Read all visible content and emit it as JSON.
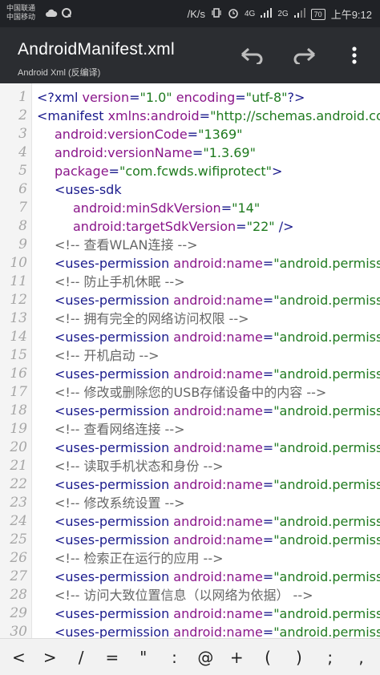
{
  "status_bar": {
    "carrier1": "中国联通",
    "carrier2": "中国移动",
    "speed": "/K/s",
    "net1": "4G",
    "net2": "2G",
    "battery": "70",
    "time": "上午9:12"
  },
  "toolbar": {
    "title": "AndroidManifest.xml",
    "subtitle": "Android Xml (反编译)"
  },
  "editor": {
    "lines": [
      {
        "n": "1",
        "parts": [
          [
            "tag",
            "<?xml "
          ],
          [
            "attr",
            "version"
          ],
          [
            "tag",
            "="
          ],
          [
            "str",
            "\"1.0\""
          ],
          [
            "tag",
            " "
          ],
          [
            "attr",
            "encoding"
          ],
          [
            "tag",
            "="
          ],
          [
            "str",
            "\"utf-8\""
          ],
          [
            "tag",
            "?>"
          ]
        ],
        "indent": 0
      },
      {
        "n": "2",
        "parts": [
          [
            "tag",
            "<manifest "
          ],
          [
            "attr",
            "xmlns:android"
          ],
          [
            "tag",
            "="
          ],
          [
            "str",
            "\"http://schemas.android.com/apk"
          ]
        ],
        "indent": 0
      },
      {
        "n": "3",
        "parts": [
          [
            "attr",
            "android:versionCode"
          ],
          [
            "tag",
            "="
          ],
          [
            "str",
            "\"1369\""
          ]
        ],
        "indent": 1
      },
      {
        "n": "4",
        "parts": [
          [
            "attr",
            "android:versionName"
          ],
          [
            "tag",
            "="
          ],
          [
            "str",
            "\"1.3.69\""
          ]
        ],
        "indent": 1
      },
      {
        "n": "5",
        "parts": [
          [
            "attr",
            "package"
          ],
          [
            "tag",
            "="
          ],
          [
            "str",
            "\"com.fcwds.wifiprotect\""
          ],
          [
            "tag",
            ">"
          ]
        ],
        "indent": 1
      },
      {
        "n": "6",
        "parts": [
          [
            "tag",
            "<uses-sdk"
          ]
        ],
        "indent": 1
      },
      {
        "n": "7",
        "parts": [
          [
            "attr",
            "android:minSdkVersion"
          ],
          [
            "tag",
            "="
          ],
          [
            "str",
            "\"14\""
          ]
        ],
        "indent": 2
      },
      {
        "n": "8",
        "parts": [
          [
            "attr",
            "android:targetSdkVersion"
          ],
          [
            "tag",
            "="
          ],
          [
            "str",
            "\"22\""
          ],
          [
            "tag",
            " />"
          ]
        ],
        "indent": 2
      },
      {
        "n": "9",
        "parts": [
          [
            "comment",
            "<!-- 查看WLAN连接 -->"
          ]
        ],
        "indent": 1
      },
      {
        "n": "10",
        "parts": [
          [
            "tag",
            "<uses-permission "
          ],
          [
            "attr",
            "android:name"
          ],
          [
            "tag",
            "="
          ],
          [
            "str",
            "\"android.permission.ACC"
          ]
        ],
        "indent": 1
      },
      {
        "n": "11",
        "parts": [
          [
            "comment",
            "<!-- 防止手机休眠 -->"
          ]
        ],
        "indent": 1
      },
      {
        "n": "12",
        "parts": [
          [
            "tag",
            "<uses-permission "
          ],
          [
            "attr",
            "android:name"
          ],
          [
            "tag",
            "="
          ],
          [
            "str",
            "\"android.permission.WAK"
          ]
        ],
        "indent": 1
      },
      {
        "n": "13",
        "parts": [
          [
            "comment",
            "<!-- 拥有完全的网络访问权限 -->"
          ]
        ],
        "indent": 1
      },
      {
        "n": "14",
        "parts": [
          [
            "tag",
            "<uses-permission "
          ],
          [
            "attr",
            "android:name"
          ],
          [
            "tag",
            "="
          ],
          [
            "str",
            "\"android.permission.INT"
          ]
        ],
        "indent": 1
      },
      {
        "n": "15",
        "parts": [
          [
            "comment",
            "<!-- 开机启动 -->"
          ]
        ],
        "indent": 1
      },
      {
        "n": "16",
        "parts": [
          [
            "tag",
            "<uses-permission "
          ],
          [
            "attr",
            "android:name"
          ],
          [
            "tag",
            "="
          ],
          [
            "str",
            "\"android.permission.REC"
          ]
        ],
        "indent": 1
      },
      {
        "n": "17",
        "parts": [
          [
            "comment",
            "<!-- 修改或删除您的USB存储设备中的内容 -->"
          ]
        ],
        "indent": 1
      },
      {
        "n": "18",
        "parts": [
          [
            "tag",
            "<uses-permission "
          ],
          [
            "attr",
            "android:name"
          ],
          [
            "tag",
            "="
          ],
          [
            "str",
            "\"android.permission.WRI"
          ]
        ],
        "indent": 1
      },
      {
        "n": "19",
        "parts": [
          [
            "comment",
            "<!-- 查看网络连接 -->"
          ]
        ],
        "indent": 1
      },
      {
        "n": "20",
        "parts": [
          [
            "tag",
            "<uses-permission "
          ],
          [
            "attr",
            "android:name"
          ],
          [
            "tag",
            "="
          ],
          [
            "str",
            "\"android.permission.ACC"
          ]
        ],
        "indent": 1
      },
      {
        "n": "21",
        "parts": [
          [
            "comment",
            "<!-- 读取手机状态和身份 -->"
          ]
        ],
        "indent": 1
      },
      {
        "n": "22",
        "parts": [
          [
            "tag",
            "<uses-permission "
          ],
          [
            "attr",
            "android:name"
          ],
          [
            "tag",
            "="
          ],
          [
            "str",
            "\"android.permission.REA"
          ]
        ],
        "indent": 1
      },
      {
        "n": "23",
        "parts": [
          [
            "comment",
            "<!-- 修改系统设置 -->"
          ]
        ],
        "indent": 1
      },
      {
        "n": "24",
        "parts": [
          [
            "tag",
            "<uses-permission "
          ],
          [
            "attr",
            "android:name"
          ],
          [
            "tag",
            "="
          ],
          [
            "str",
            "\"android.permission.WRI"
          ]
        ],
        "indent": 1
      },
      {
        "n": "25",
        "parts": [
          [
            "tag",
            "<uses-permission "
          ],
          [
            "attr",
            "android:name"
          ],
          [
            "tag",
            "="
          ],
          [
            "str",
            "\"android.permission.REA"
          ]
        ],
        "indent": 1
      },
      {
        "n": "26",
        "parts": [
          [
            "comment",
            "<!-- 检索正在运行的应用 -->"
          ]
        ],
        "indent": 1
      },
      {
        "n": "27",
        "parts": [
          [
            "tag",
            "<uses-permission "
          ],
          [
            "attr",
            "android:name"
          ],
          [
            "tag",
            "="
          ],
          [
            "str",
            "\"android.permission.GET"
          ]
        ],
        "indent": 1
      },
      {
        "n": "28",
        "parts": [
          [
            "comment",
            "<!-- 访问大致位置信息（以网络为依据） -->"
          ]
        ],
        "indent": 1
      },
      {
        "n": "29",
        "parts": [
          [
            "tag",
            "<uses-permission "
          ],
          [
            "attr",
            "android:name"
          ],
          [
            "tag",
            "="
          ],
          [
            "str",
            "\"android.permission.ACC"
          ]
        ],
        "indent": 1
      },
      {
        "n": "30",
        "parts": [
          [
            "tag",
            "<uses-permission "
          ],
          [
            "attr",
            "android:name"
          ],
          [
            "tag",
            "="
          ],
          [
            "str",
            "\"android.permission.ACC"
          ]
        ],
        "indent": 1
      }
    ]
  },
  "symbol_bar": {
    "symbols": [
      "<",
      ">",
      "/",
      "=",
      "\"",
      ":",
      "@",
      "+",
      "(",
      ")",
      ";",
      ","
    ]
  },
  "colors": {
    "status_bar_bg": "#202226",
    "toolbar_bg": "#2b2d31",
    "tag": "#1a1a8c",
    "attr": "#8a168a",
    "string": "#1f7a1f",
    "comment": "#666666"
  },
  "icons": {
    "undo": "undo-icon",
    "redo": "redo-icon",
    "more": "more-vert-icon"
  }
}
